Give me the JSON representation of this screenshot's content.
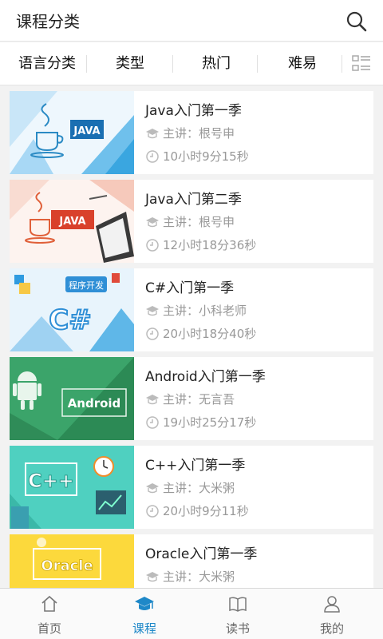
{
  "header": {
    "title": "课程分类"
  },
  "filters": [
    {
      "label": "语言分类"
    },
    {
      "label": "类型"
    },
    {
      "label": "热门"
    },
    {
      "label": "难易"
    }
  ],
  "courses": [
    {
      "title": "Java入门第一季",
      "teacher": "主讲：根号申",
      "duration": "10小时9分15秒",
      "thumb_text": "JAVA",
      "thumb_theme": "java-blue"
    },
    {
      "title": "Java入门第二季",
      "teacher": "主讲：根号申",
      "duration": "12小时18分36秒",
      "thumb_text": "JAVA",
      "thumb_theme": "java-red"
    },
    {
      "title": "C#入门第一季",
      "teacher": "主讲：小科老师",
      "duration": "20小时18分40秒",
      "thumb_text": "C#",
      "thumb_caption": "程序开发",
      "thumb_theme": "csharp-blue"
    },
    {
      "title": "Android入门第一季",
      "teacher": "主讲：无言吾",
      "duration": "19小时25分17秒",
      "thumb_text": "Android",
      "thumb_theme": "android-green"
    },
    {
      "title": "C++入门第一季",
      "teacher": "主讲：大米粥",
      "duration": "20小时9分11秒",
      "thumb_text": "C++",
      "thumb_theme": "cpp-teal"
    },
    {
      "title": "Oracle入门第一季",
      "teacher": "主讲：大米粥",
      "duration": "",
      "thumb_text": "Oracle",
      "thumb_theme": "oracle-yellow"
    }
  ],
  "tabbar": [
    {
      "label": "首页",
      "icon": "home-icon",
      "active": false
    },
    {
      "label": "课程",
      "icon": "graduation-cap-icon",
      "active": true
    },
    {
      "label": "读书",
      "icon": "book-icon",
      "active": false
    },
    {
      "label": "我的",
      "icon": "user-icon",
      "active": false
    }
  ],
  "colors": {
    "accent": "#1e88c8",
    "meta_text": "#999999",
    "background": "#f2f2f2"
  }
}
